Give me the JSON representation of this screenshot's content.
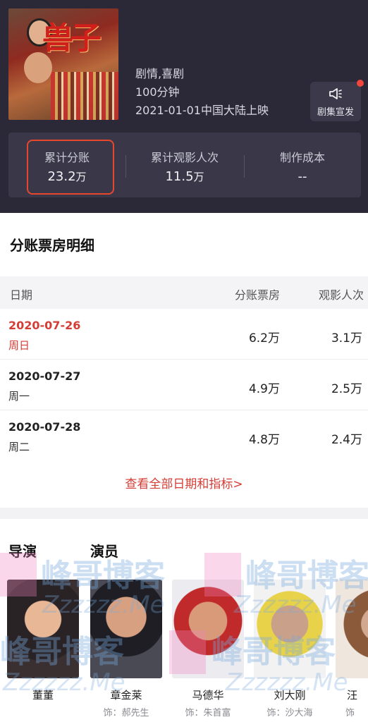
{
  "movie": {
    "genre": "剧情,喜剧",
    "duration": "100分钟",
    "release": "2021-01-01中国大陆上映",
    "poster_title": "兽子"
  },
  "promo": {
    "icon": "megaphone-icon",
    "label": "剧集宣发"
  },
  "stats": {
    "revenue_label": "累计分账",
    "revenue_value": "23.2",
    "revenue_unit": "万",
    "admissions_label": "累计观影人次",
    "admissions_value": "11.5",
    "admissions_unit": "万",
    "cost_label": "制作成本",
    "cost_value": "--"
  },
  "detail": {
    "title": "分账票房明细",
    "headers": {
      "date": "日期",
      "revenue": "分账票房",
      "admissions": "观影人次"
    },
    "rows": [
      {
        "date": "2020-07-26",
        "weekday": "周日",
        "revenue": "6.2万",
        "admissions": "3.1万"
      },
      {
        "date": "2020-07-27",
        "weekday": "周一",
        "revenue": "4.9万",
        "admissions": "2.5万"
      },
      {
        "date": "2020-07-28",
        "weekday": "周二",
        "revenue": "4.8万",
        "admissions": "2.4万"
      }
    ],
    "view_all": "查看全部日期和指标>"
  },
  "cast": {
    "director_label": "导演",
    "actor_label": "演员",
    "people": [
      {
        "name": "董董",
        "role": ""
      },
      {
        "name": "章金莱",
        "role": "饰：郝先生"
      },
      {
        "name": "马德华",
        "role": "饰：朱首富"
      },
      {
        "name": "刘大刚",
        "role": "饰：沙大海"
      },
      {
        "name": "汪",
        "role": "饰"
      }
    ]
  },
  "watermark": {
    "text": "峰哥博客",
    "sub": "Zzzzzz.Me"
  },
  "colors": {
    "accent": "#d43d36",
    "header_bg": "#2b2938",
    "highlight": "#e8462d"
  }
}
